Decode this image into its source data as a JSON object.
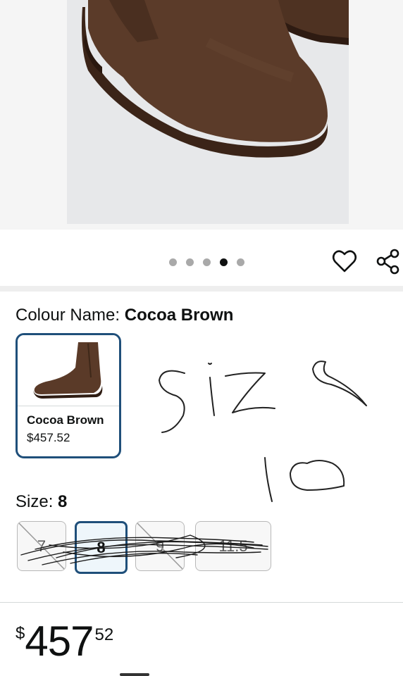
{
  "product": {
    "image_alt_icon": "chelsea-boot-photo",
    "carousel": {
      "count": 5,
      "active_index": 3
    },
    "actions": {
      "wishlist_icon": "heart-outline-icon",
      "share_icon": "share-icon"
    }
  },
  "colour": {
    "label": "Colour Name: ",
    "value": "Cocoa Brown",
    "swatches": [
      {
        "name": "Cocoa Brown",
        "price": "$457.52",
        "selected": true
      }
    ]
  },
  "handwriting": {
    "text": "size 10"
  },
  "size": {
    "label": "Size: ",
    "value": "8",
    "options": [
      {
        "label": "7",
        "available": false,
        "selected": false
      },
      {
        "label": "8",
        "available": true,
        "selected": true
      },
      {
        "label": "9",
        "available": false,
        "selected": false
      },
      {
        "label": "11.5",
        "available": true,
        "selected": false
      }
    ]
  },
  "price": {
    "symbol": "$",
    "whole": "457",
    "fraction": "52"
  },
  "colors": {
    "accent": "#1f4f7a",
    "boot": "#5a3a28",
    "sole": "#3b2418"
  }
}
